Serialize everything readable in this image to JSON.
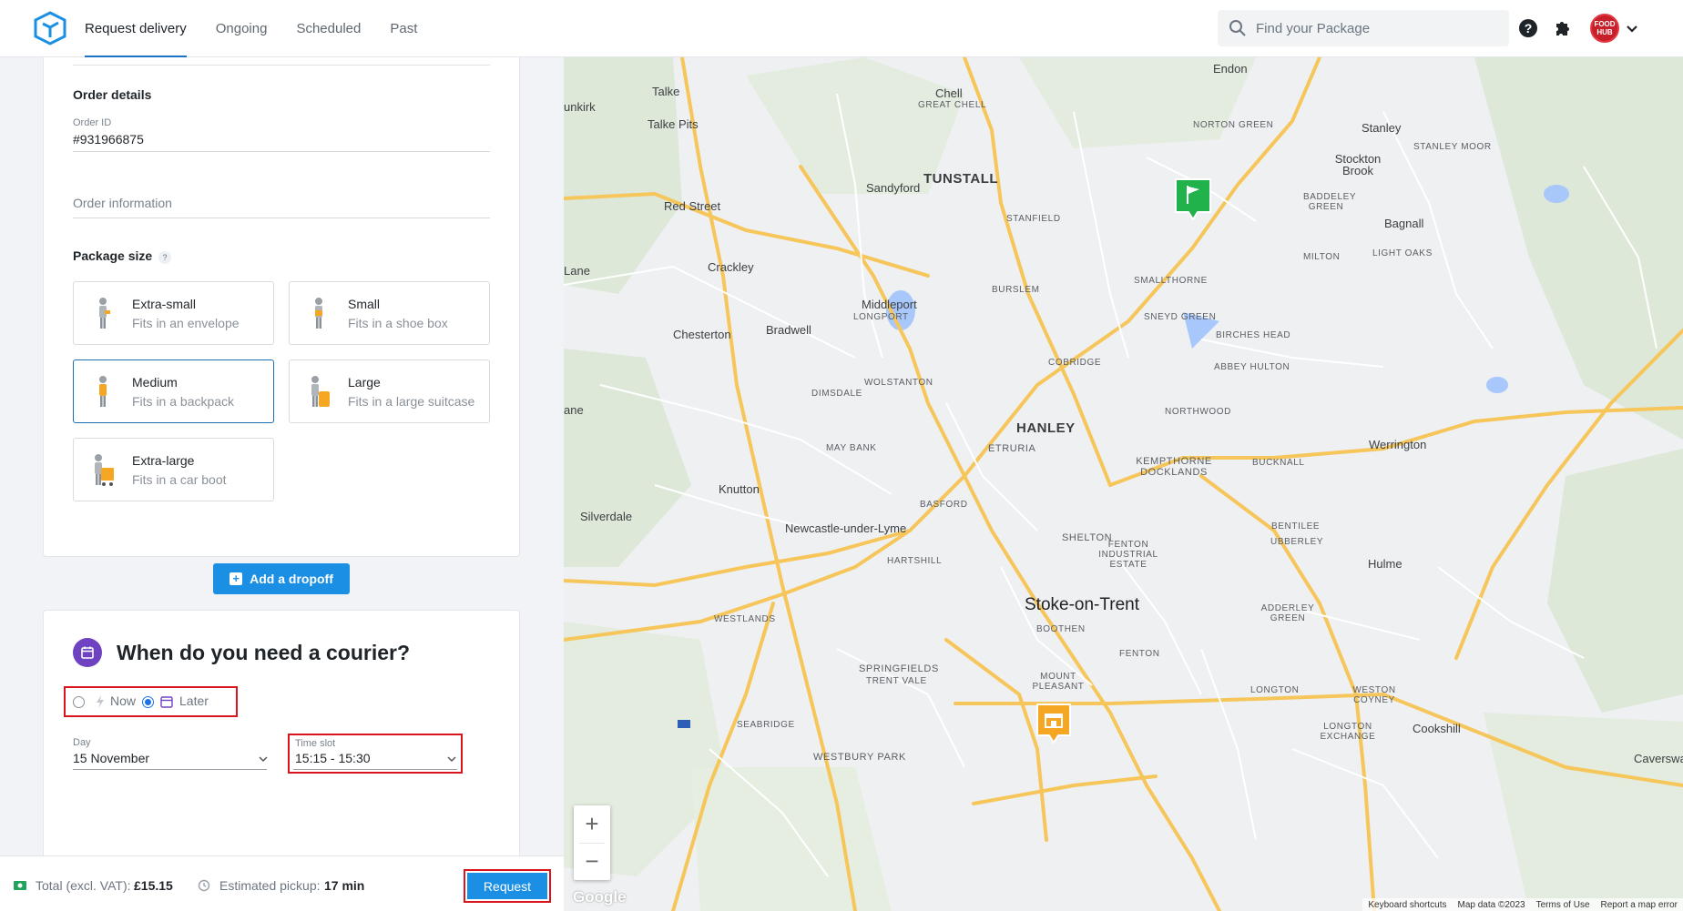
{
  "nav": {
    "tabs": [
      {
        "label": "Request delivery"
      },
      {
        "label": "Ongoing"
      },
      {
        "label": "Scheduled"
      },
      {
        "label": "Past"
      }
    ]
  },
  "search": {
    "placeholder": "Find your Package"
  },
  "avatar": {
    "text": "FOOD HUB"
  },
  "order": {
    "section_title": "Order details",
    "id_label": "Order ID",
    "id_value": "#931966875",
    "info_placeholder": "Order information"
  },
  "package": {
    "title": "Package size",
    "help": "?",
    "sizes": [
      {
        "name": "Extra-small",
        "desc": "Fits in an envelope"
      },
      {
        "name": "Small",
        "desc": "Fits in a shoe box"
      },
      {
        "name": "Medium",
        "desc": "Fits in a backpack"
      },
      {
        "name": "Large",
        "desc": "Fits in a large suitcase"
      },
      {
        "name": "Extra-large",
        "desc": "Fits in a car boot"
      }
    ],
    "selected": "Medium"
  },
  "add_dropoff_label": "Add a dropoff",
  "courier": {
    "title": "When do you need a courier?",
    "now_label": "Now",
    "later_label": "Later",
    "selected": "Later",
    "day_label": "Day",
    "day_value": "15 November",
    "slot_label": "Time slot",
    "slot_value": "15:15 - 15:30"
  },
  "footer": {
    "total_label": "Total (excl. VAT):",
    "total_value": "£15.15",
    "pickup_label": "Estimated pickup:",
    "pickup_value": "17 min",
    "request_label": "Request"
  },
  "map": {
    "labels": [
      {
        "text": "Endon"
      },
      {
        "text": "Talke"
      },
      {
        "text": "Chell"
      },
      {
        "text": "GREAT CHELL"
      },
      {
        "text": "unkirk"
      },
      {
        "text": "Talke Pits"
      },
      {
        "text": "NORTON GREEN"
      },
      {
        "text": "Stanley"
      },
      {
        "text": "STANLEY MOOR"
      },
      {
        "text": "Stockton Brook"
      },
      {
        "text": "TUNSTALL"
      },
      {
        "text": "Sandyford"
      },
      {
        "text": "Red Street"
      },
      {
        "text": "BADDELEY GREEN"
      },
      {
        "text": "Bagnall"
      },
      {
        "text": "STANFIELD"
      },
      {
        "text": "Lane"
      },
      {
        "text": "Crackley"
      },
      {
        "text": "MILTON"
      },
      {
        "text": "LIGHT OAKS"
      },
      {
        "text": "SMALLTHORNE"
      },
      {
        "text": "BURSLEM"
      },
      {
        "text": "Middleport"
      },
      {
        "text": "LONGPORT"
      },
      {
        "text": "Bradwell"
      },
      {
        "text": "Chesterton"
      },
      {
        "text": "SNEYD GREEN"
      },
      {
        "text": "BIRCHES HEAD"
      },
      {
        "text": "COBRIDGE"
      },
      {
        "text": "ABBEY HULTON"
      },
      {
        "text": "WOLSTANTON"
      },
      {
        "text": "DIMSDALE"
      },
      {
        "text": "ane"
      },
      {
        "text": "NORTHWOOD"
      },
      {
        "text": "HANLEY"
      },
      {
        "text": "Werrington"
      },
      {
        "text": "MAY BANK"
      },
      {
        "text": "ETRURIA"
      },
      {
        "text": "KEMPTHORNE DOCKLANDS"
      },
      {
        "text": "BUCKNALL"
      },
      {
        "text": "Knutton"
      },
      {
        "text": "BASFORD"
      },
      {
        "text": "Silverdale"
      },
      {
        "text": "Newcastle-under-Lyme"
      },
      {
        "text": "SHELTON"
      },
      {
        "text": "BENTILEE"
      },
      {
        "text": "UBBERLEY"
      },
      {
        "text": "FENTON INDUSTRIAL ESTATE"
      },
      {
        "text": "Hulme"
      },
      {
        "text": "HARTSHILL"
      },
      {
        "text": "Stoke-on-Trent"
      },
      {
        "text": "ADDERLEY GREEN"
      },
      {
        "text": "WESTLANDS"
      },
      {
        "text": "BOOTHEN"
      },
      {
        "text": "FENTON"
      },
      {
        "text": "SPRINGFIELDS"
      },
      {
        "text": "TRENT VALE"
      },
      {
        "text": "MOUNT PLEASANT"
      },
      {
        "text": "LONGTON"
      },
      {
        "text": "WESTON COYNEY"
      },
      {
        "text": "SEABRIDGE"
      },
      {
        "text": "LONGTON EXCHANGE"
      },
      {
        "text": "Cookshill"
      },
      {
        "text": "WESTBURY PARK"
      },
      {
        "text": "Caverswa"
      }
    ],
    "attribution": [
      "Keyboard shortcuts",
      "Map data ©2023",
      "Terms of Use",
      "Report a map error"
    ],
    "google": "Google"
  },
  "colors": {
    "accent": "#1a8fe3",
    "highlight": "#d8141c",
    "calendar": "#6f42c1",
    "dropoff_pin": "#21b24b",
    "pickup_pin": "#f5a623"
  }
}
